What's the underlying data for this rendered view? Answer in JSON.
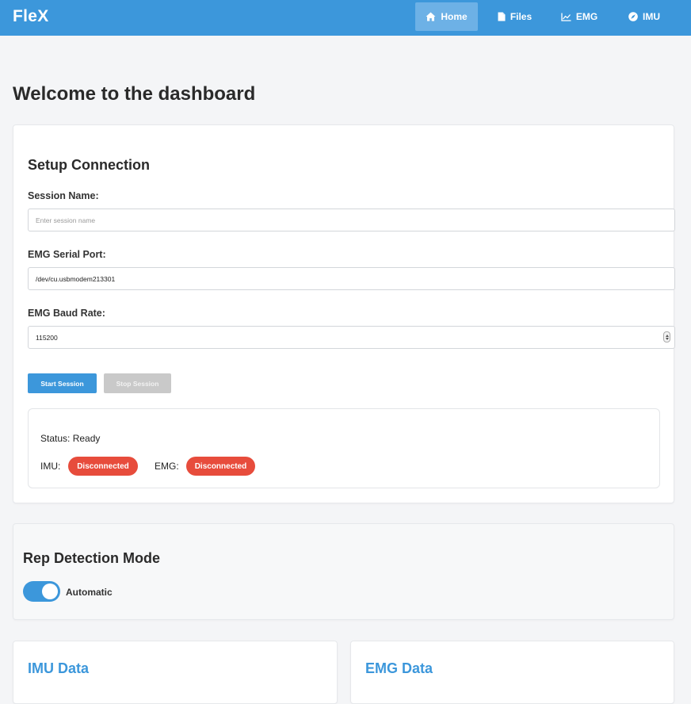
{
  "navbar": {
    "brand": "FleX",
    "items": [
      {
        "label": "Home",
        "icon": "home-icon",
        "active": true
      },
      {
        "label": "Files",
        "icon": "file-icon",
        "active": false
      },
      {
        "label": "EMG",
        "icon": "chart-line-icon",
        "active": false
      },
      {
        "label": "IMU",
        "icon": "compass-icon",
        "active": false
      }
    ]
  },
  "page_title": "Welcome to the dashboard",
  "setup": {
    "title": "Setup Connection",
    "session_name_label": "Session Name:",
    "session_name_placeholder": "Enter session name",
    "session_name_value": "",
    "serial_port_label": "EMG Serial Port:",
    "serial_port_value": "/dev/cu.usbmodem213301",
    "baud_rate_label": "EMG Baud Rate:",
    "baud_rate_value": "115200",
    "start_button": "Start Session",
    "stop_button": "Stop Session",
    "status_text": "Status: Ready",
    "imu_label": "IMU:",
    "imu_status": "Disconnected",
    "emg_label": "EMG:",
    "emg_status": "Disconnected"
  },
  "rep_detection": {
    "title": "Rep Detection Mode",
    "toggle_on": true,
    "toggle_label": "Automatic"
  },
  "imu_data": {
    "title": "IMU Data"
  },
  "emg_data": {
    "title": "EMG Data"
  },
  "colors": {
    "primary": "#3c97db",
    "navbar_active": "#6db1e6",
    "disconnected_badge": "#e74c3c",
    "disabled_button": "#c9c9c9"
  }
}
